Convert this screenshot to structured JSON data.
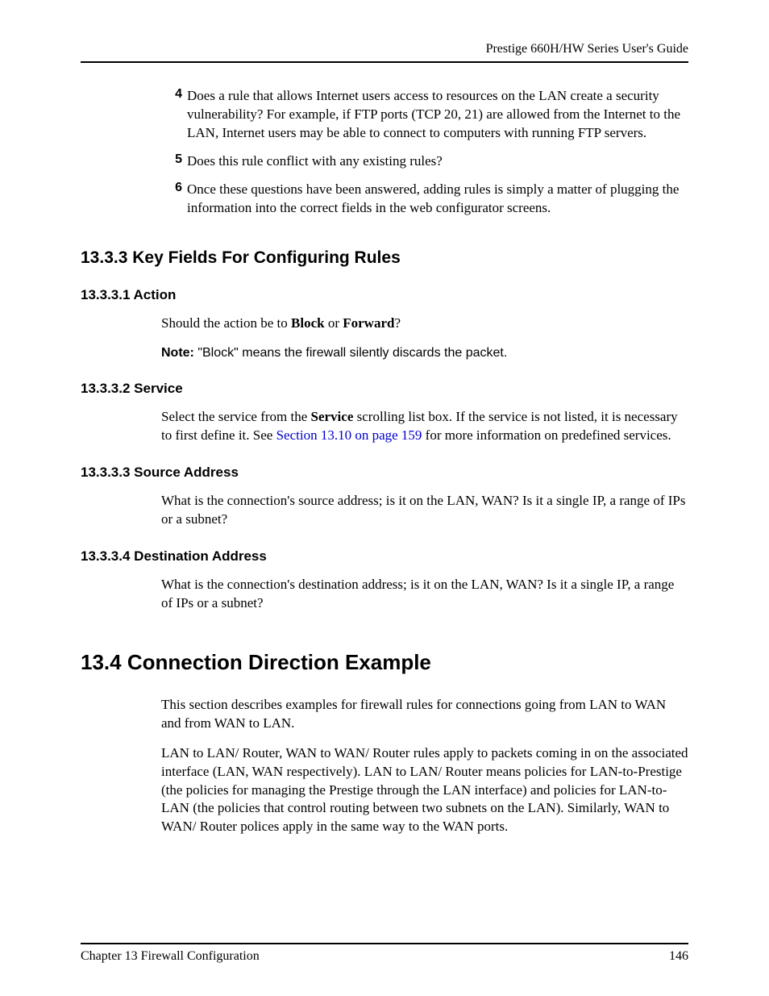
{
  "header": {
    "title": "Prestige 660H/HW Series User's Guide"
  },
  "list": {
    "items": [
      {
        "num": "4",
        "text": "Does a rule that allows Internet users access to resources on the LAN create a security vulnerability? For example, if FTP ports (TCP 20, 21) are allowed from the Internet to the LAN, Internet users may be able to connect to computers with running FTP servers."
      },
      {
        "num": "5",
        "text": "Does this rule conflict with any existing rules?"
      },
      {
        "num": "6",
        "text": "Once these questions have been answered, adding rules is simply a matter of plugging the information into the correct fields in the web configurator screens."
      }
    ]
  },
  "sections": {
    "keyfields_heading": "13.3.3  Key Fields For Configuring Rules",
    "action": {
      "heading": "13.3.3.1  Action",
      "p_before": "Should the action be to ",
      "p_block": "Block",
      "p_or": " or ",
      "p_forward": "Forward",
      "p_q": "?",
      "note_label": "Note: ",
      "note_text": "\"Block\" means the firewall silently discards the packet."
    },
    "service": {
      "heading": "13.3.3.2  Service",
      "p_before": "Select the service from the ",
      "p_bold": "Service",
      "p_mid": " scrolling list box. If the service is not listed, it is necessary to first define it. See ",
      "link": "Section 13.10 on page 159",
      "p_after": " for more information on predefined services."
    },
    "source": {
      "heading": "13.3.3.3  Source Address",
      "p": "What is the connection's source address; is it on the LAN, WAN? Is it a single IP, a range of IPs or a subnet?"
    },
    "dest": {
      "heading": "13.3.3.4  Destination Address",
      "p": "What is the connection's destination address; is it on the LAN,  WAN? Is it a single IP, a range of IPs or a subnet?"
    },
    "conn": {
      "heading": "13.4  Connection Direction Example",
      "p1": "This section describes examples for firewall rules for connections going from LAN to WAN and from WAN to LAN.",
      "p2": "LAN to LAN/ Router, WAN to WAN/ Router rules apply to packets coming in on the associated interface (LAN, WAN respectively). LAN to LAN/ Router means policies for LAN-to-Prestige (the policies for managing the Prestige through the LAN interface) and policies for LAN-to-LAN (the policies that control routing between two subnets on the LAN). Similarly, WAN to WAN/ Router polices apply in the same way to the WAN ports."
    }
  },
  "footer": {
    "chapter": "Chapter 13 Firewall Configuration",
    "page": "146"
  }
}
